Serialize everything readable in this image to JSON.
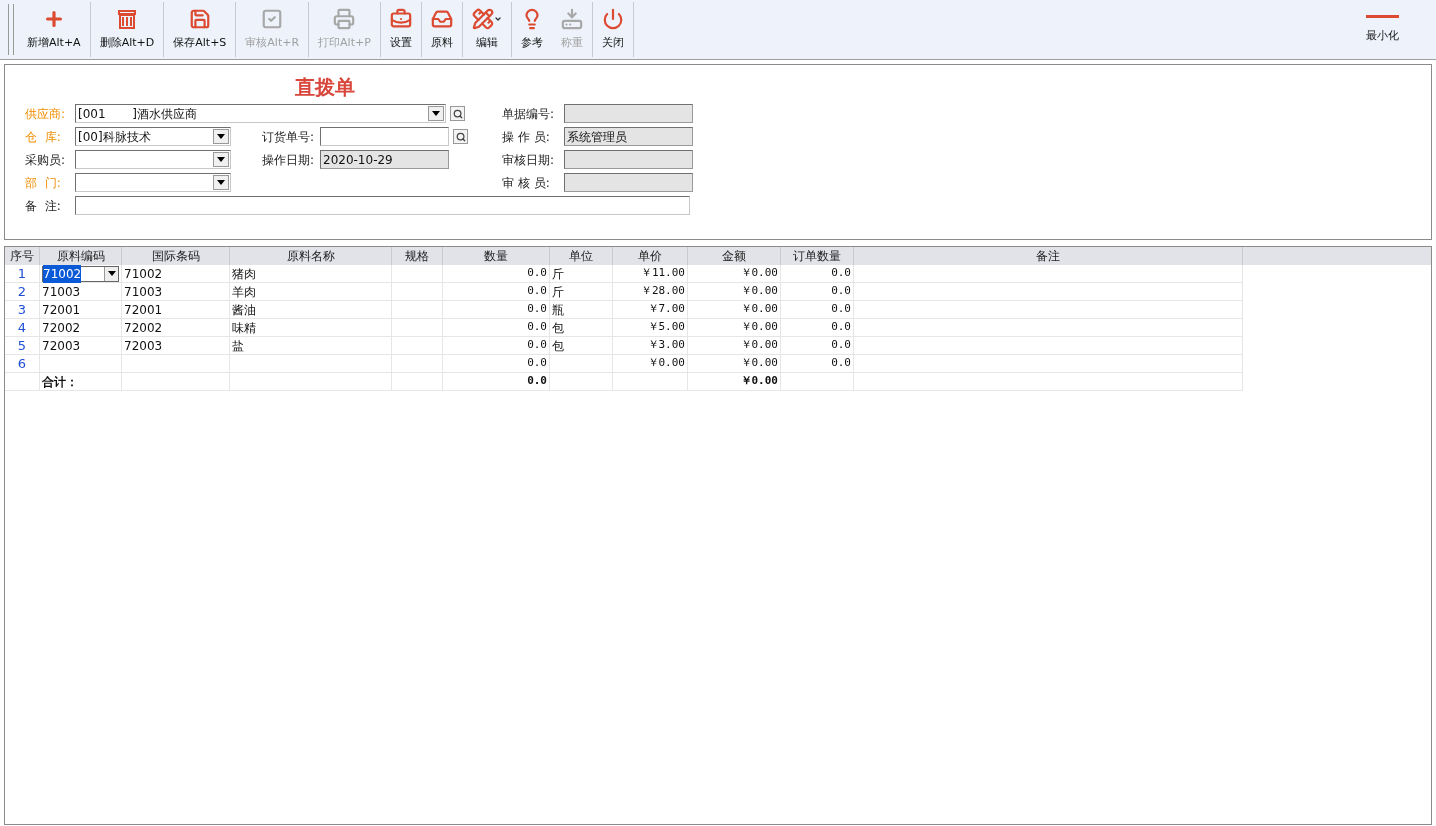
{
  "toolbar": {
    "groups": [
      [
        {
          "label": "新增Alt+A",
          "disabled": false,
          "menu": false
        }
      ],
      [
        {
          "label": "删除Alt+D",
          "disabled": false,
          "menu": false
        }
      ],
      [
        {
          "label": "保存Alt+S",
          "disabled": false,
          "menu": false
        }
      ],
      [
        {
          "label": "审核Alt+R",
          "disabled": true,
          "menu": false
        }
      ],
      [
        {
          "label": "打印Alt+P",
          "disabled": true,
          "menu": false
        }
      ],
      [
        {
          "label": "设置",
          "disabled": false,
          "menu": false
        }
      ],
      [
        {
          "label": "原料",
          "disabled": false,
          "menu": false
        }
      ],
      [
        {
          "label": "编辑",
          "disabled": false,
          "menu": true
        }
      ],
      [
        {
          "label": "参考",
          "disabled": false,
          "menu": false
        },
        {
          "label": "称重",
          "disabled": true,
          "menu": false
        }
      ],
      [
        {
          "label": "关闭",
          "disabled": false,
          "menu": false
        }
      ]
    ],
    "minimize": {
      "label": "最小化"
    }
  },
  "form": {
    "title": "直拨单",
    "rows": [
      [
        {
          "label": "供应商:",
          "value": "[001       ]酒水供应商",
          "required": true,
          "kind": "dropdown",
          "search": true
        },
        {
          "label": "单据编号:",
          "required": false,
          "kind": "readonly",
          "search": false
        }
      ],
      [
        {
          "label": "仓  库:",
          "value": "[00]科脉技术",
          "required": true,
          "kind": "dropdown",
          "search": false
        },
        {
          "label": "订货单号:",
          "required": false,
          "kind": "text",
          "search": true
        },
        {
          "label": "操 作 员:",
          "value": "系统管理员",
          "required": false,
          "kind": "readonly",
          "search": false
        }
      ],
      [
        {
          "label": "采购员:",
          "required": false,
          "kind": "dropdown",
          "search": false
        },
        {
          "label": "操作日期:",
          "value": "2020-10-29",
          "required": false,
          "kind": "readonly",
          "search": false
        },
        {
          "label": "审核日期:",
          "required": false,
          "kind": "readonly",
          "search": false
        }
      ],
      [
        {
          "label": "部  门:",
          "required": true,
          "kind": "dropdown",
          "search": false
        },
        {
          "label": "审 核 员:",
          "required": false,
          "kind": "readonly",
          "search": false
        }
      ],
      [
        {
          "label": "备  注:",
          "required": false,
          "kind": "text",
          "search": false
        }
      ]
    ]
  },
  "table": {
    "columns": [
      {
        "label": "序号",
        "kind": "index"
      },
      {
        "label": "原料编码",
        "kind": "text"
      },
      {
        "label": "国际条码",
        "kind": "text"
      },
      {
        "label": "原料名称",
        "kind": "text"
      },
      {
        "label": "规格",
        "kind": "text"
      },
      {
        "label": "数量",
        "kind": "number"
      },
      {
        "label": "单位",
        "kind": "text"
      },
      {
        "label": "单价",
        "kind": "number"
      },
      {
        "label": "金额",
        "kind": "number"
      },
      {
        "label": "订单数量",
        "kind": "number"
      },
      {
        "label": "备注",
        "kind": "text"
      }
    ],
    "rows": [
      {
        "selected": true,
        "cells": [
          "1",
          "71002",
          "71002",
          "猪肉",
          null,
          "0.0",
          "斤",
          "￥11.00",
          "￥0.00",
          "0.0",
          null
        ]
      },
      {
        "selected": false,
        "cells": [
          "2",
          "71003",
          "71003",
          "羊肉",
          null,
          "0.0",
          "斤",
          "￥28.00",
          "￥0.00",
          "0.0",
          null
        ]
      },
      {
        "selected": false,
        "cells": [
          "3",
          "72001",
          "72001",
          "酱油",
          null,
          "0.0",
          "瓶",
          "￥7.00",
          "￥0.00",
          "0.0",
          null
        ]
      },
      {
        "selected": false,
        "cells": [
          "4",
          "72002",
          "72002",
          "味精",
          null,
          "0.0",
          "包",
          "￥5.00",
          "￥0.00",
          "0.0",
          null
        ]
      },
      {
        "selected": false,
        "cells": [
          "5",
          "72003",
          "72003",
          "盐",
          null,
          "0.0",
          "包",
          "￥3.00",
          "￥0.00",
          "0.0",
          null
        ]
      },
      {
        "selected": false,
        "cells": [
          "6",
          null,
          null,
          null,
          null,
          "0.0",
          null,
          "￥0.00",
          "￥0.00",
          "0.0",
          null
        ]
      }
    ],
    "total": {
      "cells": [
        null,
        "合计：",
        null,
        null,
        null,
        "0.0",
        null,
        null,
        "￥0.00",
        null,
        null
      ]
    }
  }
}
